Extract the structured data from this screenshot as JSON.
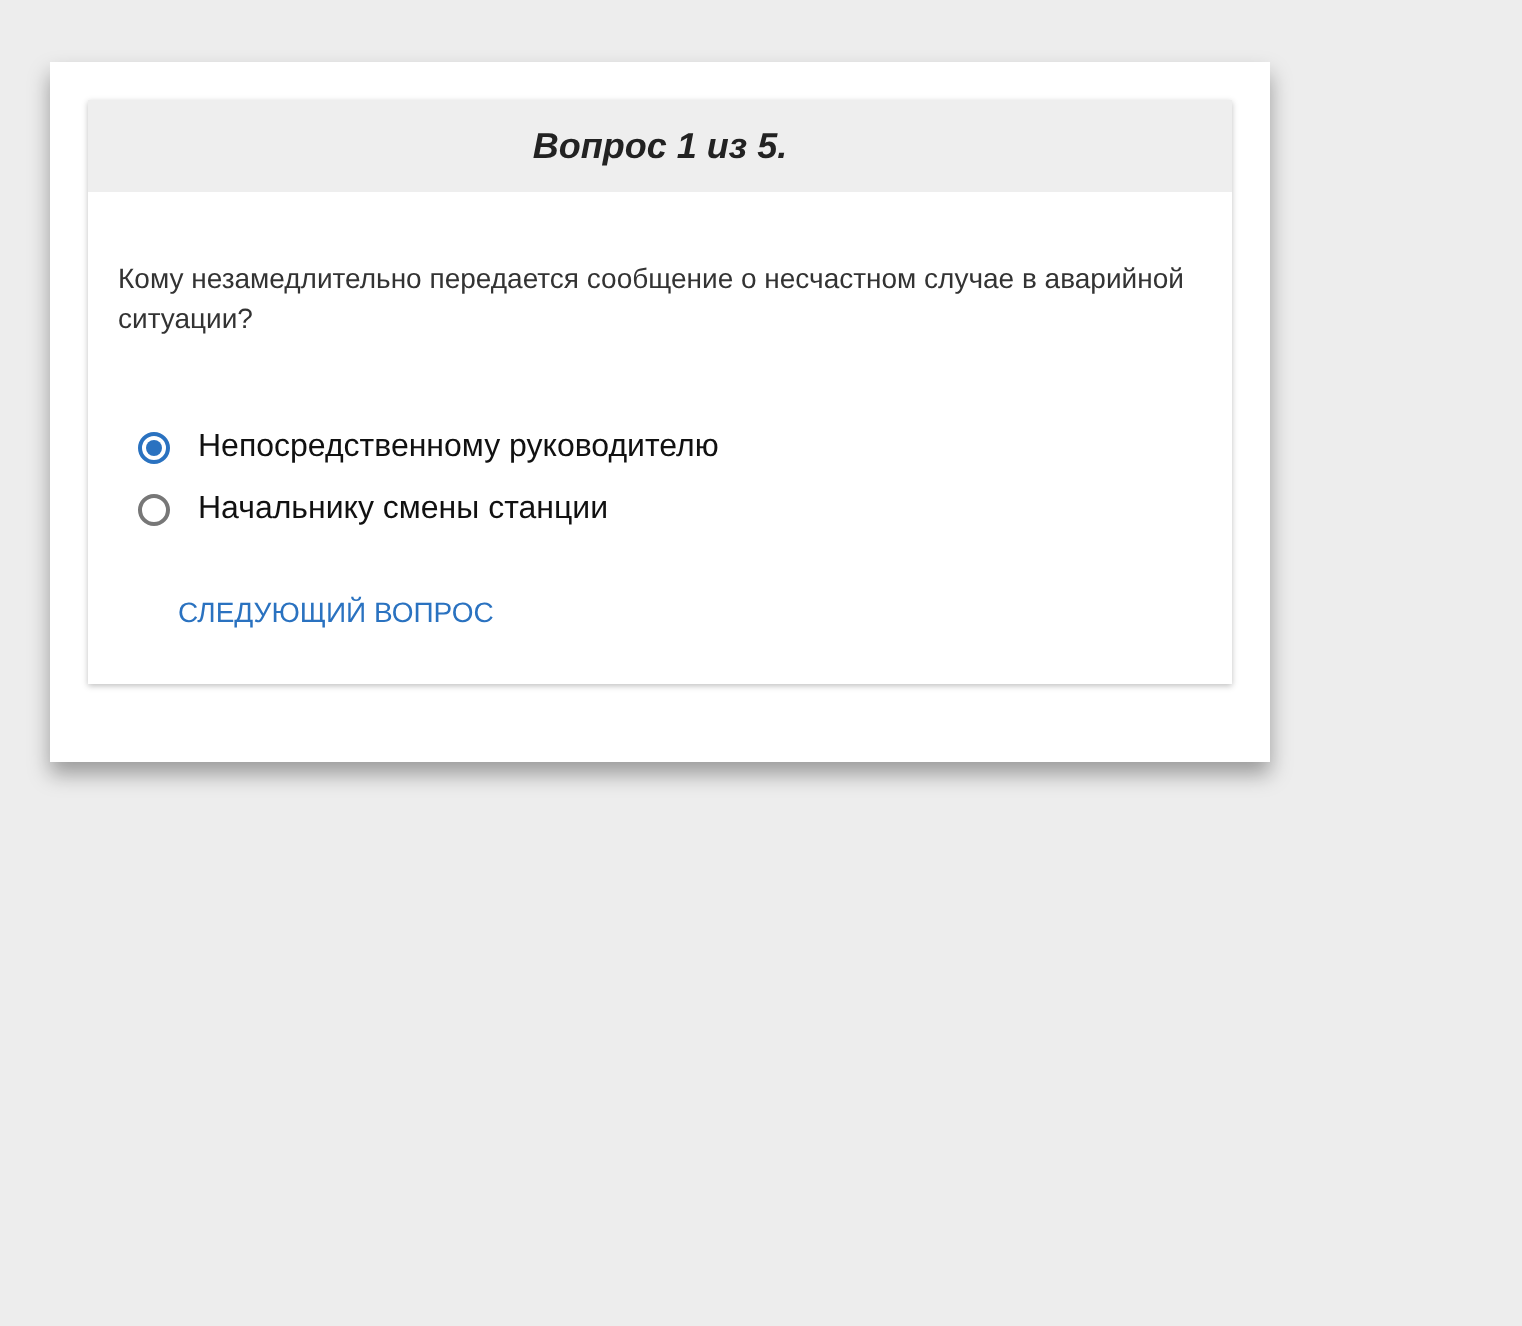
{
  "header": {
    "title": "Вопрос 1 из 5."
  },
  "question": "Кому незамедлительно передается сообщение о несчастном случае в аварийной ситуации?",
  "options": [
    {
      "label": "Непосредственному руководителю",
      "selected": true
    },
    {
      "label": "Начальнику смены станции",
      "selected": false
    }
  ],
  "next_button": "СЛЕДУЮЩИЙ ВОПРОС"
}
